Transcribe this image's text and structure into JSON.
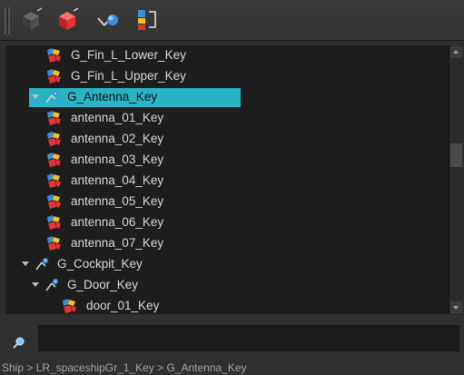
{
  "toolbar": {
    "buttons": [
      {
        "icon": "dark-cube-icon"
      },
      {
        "icon": "red-cube-icon"
      },
      {
        "icon": "link-node-icon"
      },
      {
        "icon": "hierarchy-select-icon"
      }
    ]
  },
  "tree": {
    "items": [
      {
        "label": "G_Fin_L_Lower_Key",
        "type": "key",
        "depth": 2
      },
      {
        "label": "G_Fin_L_Upper_Key",
        "type": "key",
        "depth": 2
      },
      {
        "label": "G_Antenna_Key",
        "type": "group",
        "depth": 1,
        "expanded": true,
        "selected": true
      },
      {
        "label": "antenna_01_Key",
        "type": "key",
        "depth": 2
      },
      {
        "label": "antenna_02_Key",
        "type": "key",
        "depth": 2
      },
      {
        "label": "antenna_03_Key",
        "type": "key",
        "depth": 2
      },
      {
        "label": "antenna_04_Key",
        "type": "key",
        "depth": 2
      },
      {
        "label": "antenna_05_Key",
        "type": "key",
        "depth": 2
      },
      {
        "label": "antenna_06_Key",
        "type": "key",
        "depth": 2
      },
      {
        "label": "antenna_07_Key",
        "type": "key",
        "depth": 2
      },
      {
        "label": "G_Cockpit_Key",
        "type": "group",
        "depth": 0,
        "expanded": true
      },
      {
        "label": "G_Door_Key",
        "type": "group",
        "depth": 1,
        "expanded": true
      },
      {
        "label": "door_01_Key",
        "type": "key",
        "depth": 3
      }
    ]
  },
  "search": {
    "value": "",
    "placeholder": ""
  },
  "status": {
    "path": "Ship > LR_spaceshipGr_1_Key > G_Antenna_Key"
  },
  "colors": {
    "selection": "#29b3c7",
    "background": "#1d1d1d"
  }
}
